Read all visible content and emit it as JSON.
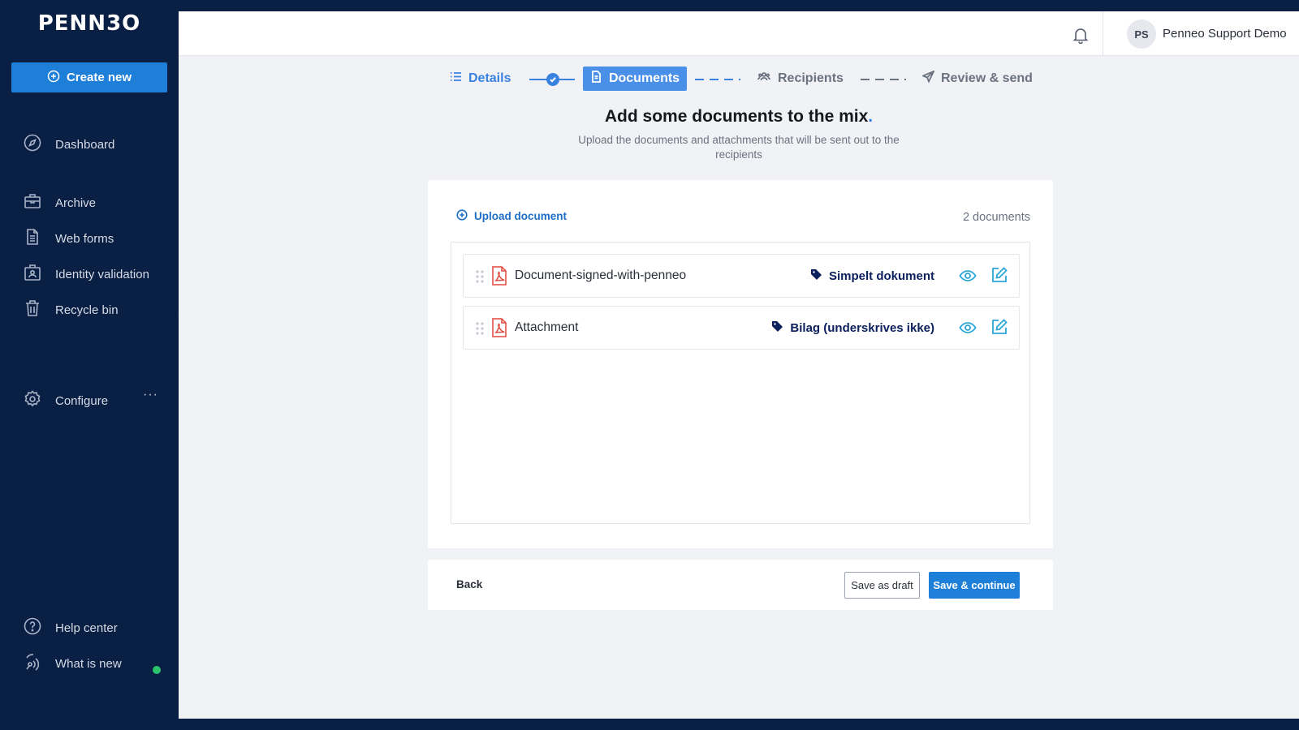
{
  "app": {
    "logo_text": "PENN3O"
  },
  "sidebar": {
    "create_label": "Create new",
    "items": [
      {
        "label": "Dashboard",
        "icon": "compass-icon"
      },
      {
        "label": "Archive",
        "icon": "briefcase-icon"
      },
      {
        "label": "Web forms",
        "icon": "document-icon"
      },
      {
        "label": "Identity validation",
        "icon": "id-card-icon"
      },
      {
        "label": "Recycle bin",
        "icon": "trash-icon"
      },
      {
        "label": "Configure",
        "icon": "gear-icon"
      },
      {
        "label": "Help center",
        "icon": "help-icon"
      },
      {
        "label": "What is new",
        "icon": "broadcast-icon"
      }
    ],
    "configure_more": "···"
  },
  "header": {
    "avatar_initials": "PS",
    "user_name": "Penneo Support Demo"
  },
  "stepper": {
    "steps": [
      {
        "label": "Details",
        "state": "done"
      },
      {
        "label": "Documents",
        "state": "active"
      },
      {
        "label": "Recipients",
        "state": "pending"
      },
      {
        "label": "Review & send",
        "state": "pending"
      }
    ]
  },
  "main": {
    "title": "Add some documents to the mix",
    "title_dot": ".",
    "subtitle": "Upload the documents and attachments that will be sent out to the recipients",
    "upload_label": "Upload document",
    "document_count": "2 documents",
    "documents": [
      {
        "name": "Document-signed-with-penneo",
        "type": "Simpelt dokument"
      },
      {
        "name": "Attachment",
        "type": "Bilag (underskrives ikke)"
      }
    ]
  },
  "footer": {
    "back_label": "Back",
    "draft_label": "Save as draft",
    "continue_label": "Save & continue"
  },
  "colors": {
    "sidebar_bg": "#0a1f44",
    "accent": "#1e7fd9",
    "step_active": "#4a8fe8",
    "tag_color": "#0a1f5c",
    "icon_cyan": "#2aa7d6",
    "pdf_red": "#e0463a",
    "status_online": "#2bc46a"
  }
}
